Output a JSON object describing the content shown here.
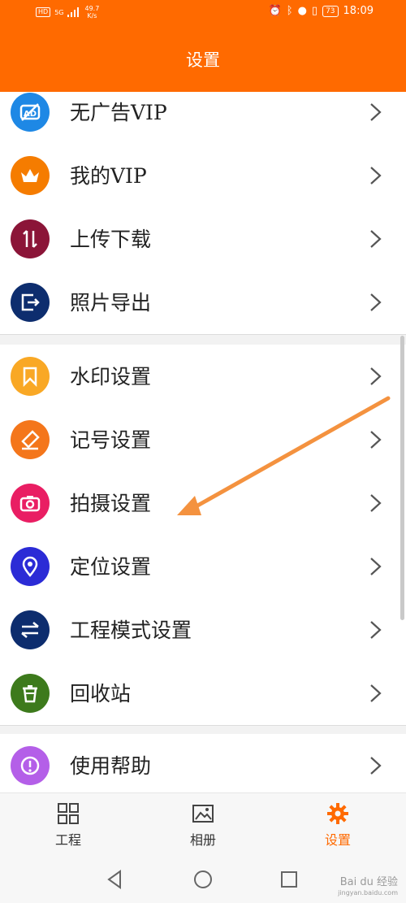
{
  "status_bar": {
    "left_badge": "HD",
    "signal": "5G",
    "speed_value": "49.7",
    "speed_unit": "K/s",
    "battery": "73",
    "time": "18:09"
  },
  "header": {
    "title": "设置"
  },
  "colors": {
    "brand": "#ff6a00",
    "arrow": "#f4923f"
  },
  "settings": {
    "items": [
      {
        "label": "无广告VIP",
        "icon": "no-ads-icon",
        "color": "#1e88e5"
      },
      {
        "label": "我的VIP",
        "icon": "crown-icon",
        "color": "#f57c00"
      },
      {
        "label": "上传下载",
        "icon": "transfer-icon",
        "color": "#8b1538"
      },
      {
        "label": "照片导出",
        "icon": "export-icon",
        "color": "#0d2d6e"
      },
      {
        "label": "水印设置",
        "icon": "bookmark-icon",
        "color": "#f9a825"
      },
      {
        "label": "记号设置",
        "icon": "marker-icon",
        "color": "#f4761b"
      },
      {
        "label": "拍摄设置",
        "icon": "camera-icon",
        "color": "#e91e63"
      },
      {
        "label": "定位设置",
        "icon": "location-pin-icon",
        "color": "#2b2bd6"
      },
      {
        "label": "工程模式设置",
        "icon": "mode-switch-icon",
        "color": "#0d2d6e"
      },
      {
        "label": "回收站",
        "icon": "trash-icon",
        "color": "#3d7a1c"
      },
      {
        "label": "使用帮助",
        "icon": "help-icon",
        "color": "#b45fe8"
      }
    ]
  },
  "bottom_nav": {
    "tabs": [
      {
        "label": "工程",
        "icon": "grid-icon"
      },
      {
        "label": "相册",
        "icon": "album-icon"
      },
      {
        "label": "设置",
        "icon": "gear-icon",
        "active": true
      }
    ]
  },
  "watermark": {
    "text": "Bai du 经验",
    "url": "jingyan.baidu.com"
  }
}
